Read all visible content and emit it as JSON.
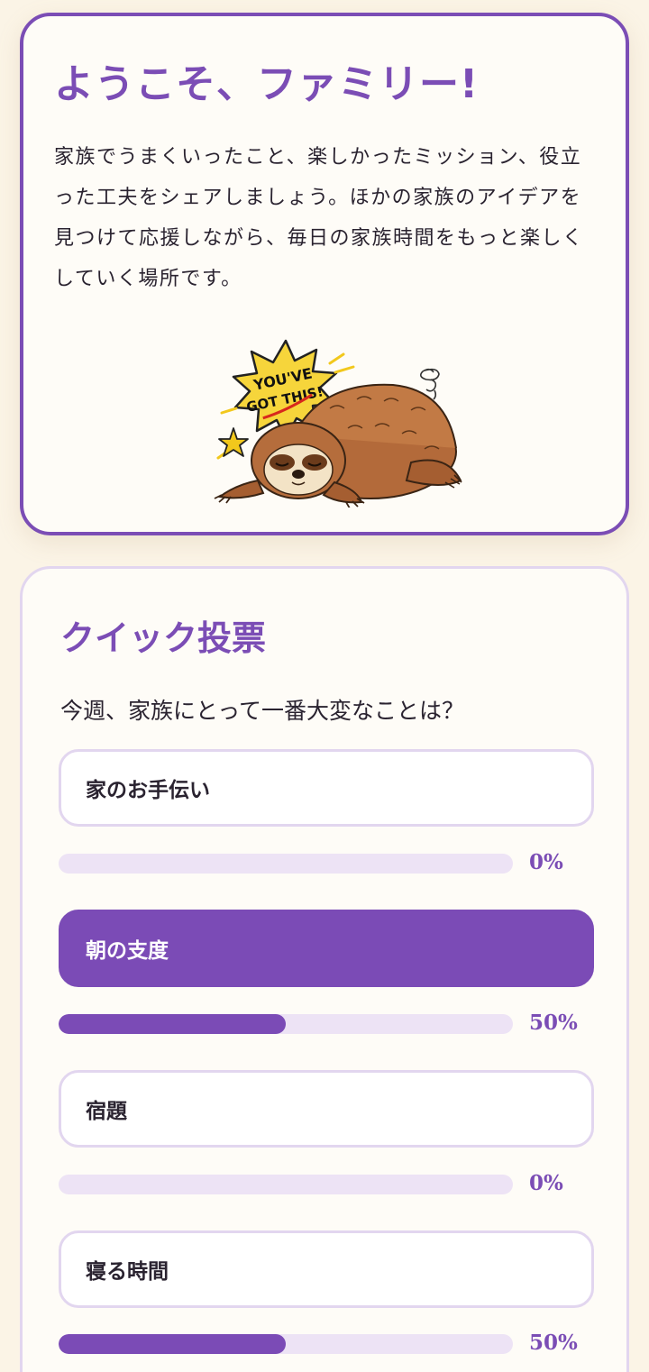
{
  "welcome": {
    "title": "ようこそ、ファミリー!",
    "text": "家族でうまくいったこと、楽しかったミッション、役立った工夫をシェアしましょう。ほかの家族のアイデアを見つけて応援しながら、毎日の家族時間をもっと楽しくしていく場所です。",
    "sticker_text_line1": "YOU'VE",
    "sticker_text_line2": "GOT THIS!"
  },
  "poll": {
    "title": "クイック投票",
    "question": "今週、家族にとって一番大変なことは？",
    "options": [
      {
        "label": "家のお手伝い",
        "percent": 0,
        "percent_label": "0%",
        "selected": false
      },
      {
        "label": "朝の支度",
        "percent": 50,
        "percent_label": "50%",
        "selected": true
      },
      {
        "label": "宿題",
        "percent": 0,
        "percent_label": "0%",
        "selected": false
      },
      {
        "label": "寝る時間",
        "percent": 50,
        "percent_label": "50%",
        "selected": false
      }
    ]
  },
  "colors": {
    "accent": "#7b4db5",
    "background": "#fbf4e6",
    "card": "#fefcf7",
    "track": "#ede3f5"
  }
}
